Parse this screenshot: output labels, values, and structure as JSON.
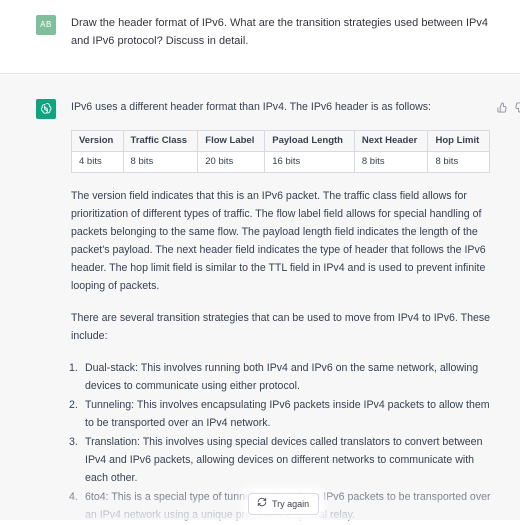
{
  "user": {
    "avatar_initials": "AB",
    "avatar_color": "#7fbf9c",
    "message": "Draw the header format of IPv6. What are the transition strategies used between IPv4 and IPv6 protocol? Discuss in detail."
  },
  "assistant": {
    "avatar_icon": "openai-logo-icon",
    "avatar_color": "#10a37f",
    "intro": "IPv6 uses a different header format than IPv4. The IPv6 header is as follows:",
    "table": {
      "headers": [
        "Version",
        "Traffic Class",
        "Flow Label",
        "Payload Length",
        "Next Header",
        "Hop Limit"
      ],
      "rows": [
        [
          "4 bits",
          "8 bits",
          "20 bits",
          "16 bits",
          "8 bits",
          "8 bits"
        ]
      ]
    },
    "paragraph1": "The version field indicates that this is an IPv6 packet. The traffic class field allows for prioritization of different types of traffic. The flow label field allows for special handling of packets belonging to the same flow. The payload length field indicates the length of the packet's payload. The next header field indicates the type of header that follows the IPv6 header. The hop limit field is similar to the TTL field in IPv4 and is used to prevent infinite looping of packets.",
    "paragraph2": "There are several transition strategies that can be used to move from IPv4 to IPv6. These include:",
    "list": [
      {
        "num": "1.",
        "text": "Dual-stack: This involves running both IPv4 and IPv6 on the same network, allowing devices to communicate using either protocol."
      },
      {
        "num": "2.",
        "text": "Tunneling: This involves encapsulating IPv6 packets inside IPv4 packets to allow them to be transported over an IPv4 network."
      },
      {
        "num": "3.",
        "text": "Translation: This involves using special devices called translators to convert between IPv4 and IPv6 packets, allowing devices on different networks to communicate with each other."
      },
      {
        "num": "4.",
        "text": "6to4: This is a special type of tunneling that allows IPv6 packets to be transported over an IPv4 network using a unique prefix and a special relay."
      }
    ],
    "feedback_icons": [
      "thumbs-up-icon",
      "thumbs-down-icon"
    ]
  },
  "try_again": {
    "label": "Try again",
    "icon": "refresh-icon"
  }
}
